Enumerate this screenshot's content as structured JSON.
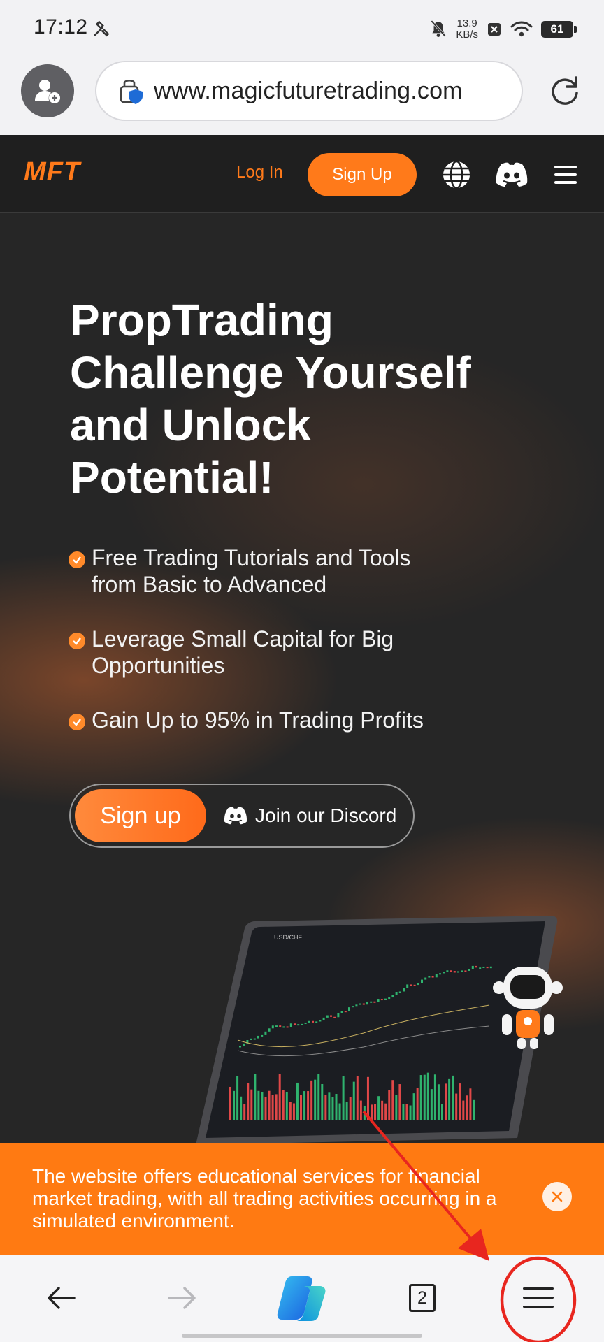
{
  "status_bar": {
    "time": "17:12",
    "net_speed_value": "13.9",
    "net_speed_unit": "KB/s",
    "battery": "61"
  },
  "browser": {
    "url": "www.magicfuturetrading.com",
    "tabs_count": "2"
  },
  "site": {
    "logo": "MFT",
    "nav": {
      "login": "Log In",
      "signup": "Sign Up"
    },
    "hero": {
      "title_line1": "PropTrading",
      "title_line2": "Challenge Yourself",
      "title_line3": "and Unlock",
      "title_line4": "Potential!"
    },
    "features": [
      {
        "text": "Free Trading Tutorials and Tools from Basic to Advanced"
      },
      {
        "text": "Leverage Small Capital for Big Opportunities"
      },
      {
        "text": "Gain Up to 95% in Trading Profits"
      }
    ],
    "cta": {
      "signup": "Sign up",
      "discord": "Join our Discord"
    },
    "tablet_pair": "USD/CHF",
    "disclaimer": "The website offers educational services for financial market trading, with all trading activities occurring in a simulated environment."
  },
  "colors": {
    "brand_orange": "#ff7a1a",
    "annotation_red": "#e8261f"
  }
}
